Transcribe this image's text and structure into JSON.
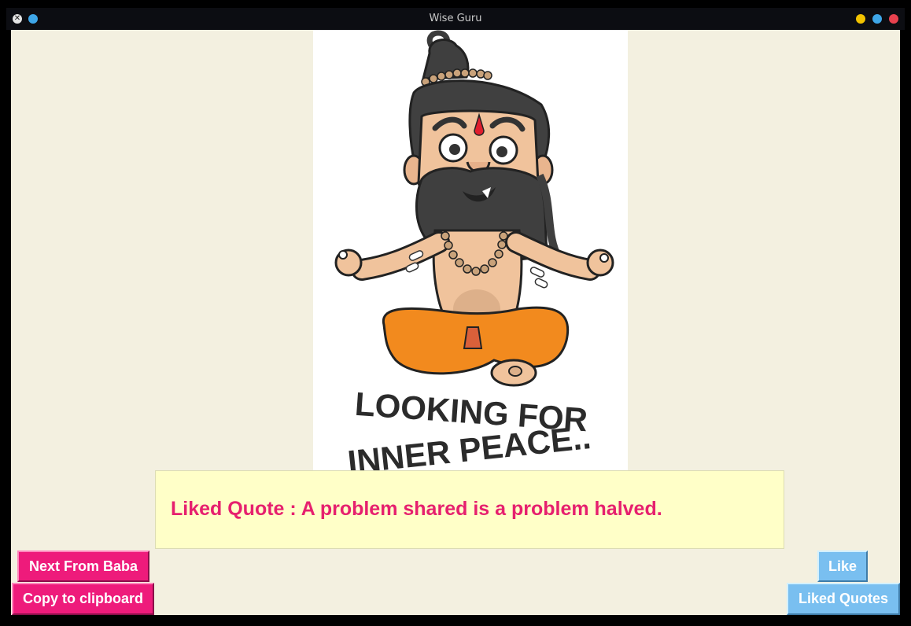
{
  "window": {
    "title": "Wise Guru",
    "controls": [
      {
        "name": "minimize",
        "color": "#f2c200"
      },
      {
        "name": "maximize",
        "color": "#3ea6e8"
      },
      {
        "name": "close",
        "color": "#e8414e"
      }
    ],
    "left_controls": [
      {
        "name": "close-icon",
        "color": "#e4e4e4"
      },
      {
        "name": "blue-dot",
        "color": "#3ea6e8"
      }
    ]
  },
  "image": {
    "caption_line1": "LOOKING FOR",
    "caption_line2": "INNER PEACE..",
    "subject": "cartoon-meditating-sadhu"
  },
  "quote": {
    "text": "Liked Quote : A problem shared is a problem halved."
  },
  "buttons": {
    "next": "Next From Baba",
    "copy": "Copy to clipboard",
    "like": "Like",
    "liked_quotes": "Liked Quotes"
  },
  "colors": {
    "pink_accent": "#ee1b7b",
    "blue_accent": "#79bff0",
    "quote_bg": "#ffffc8",
    "quote_text": "#e6206e",
    "content_bg": "#f3f0e0"
  }
}
